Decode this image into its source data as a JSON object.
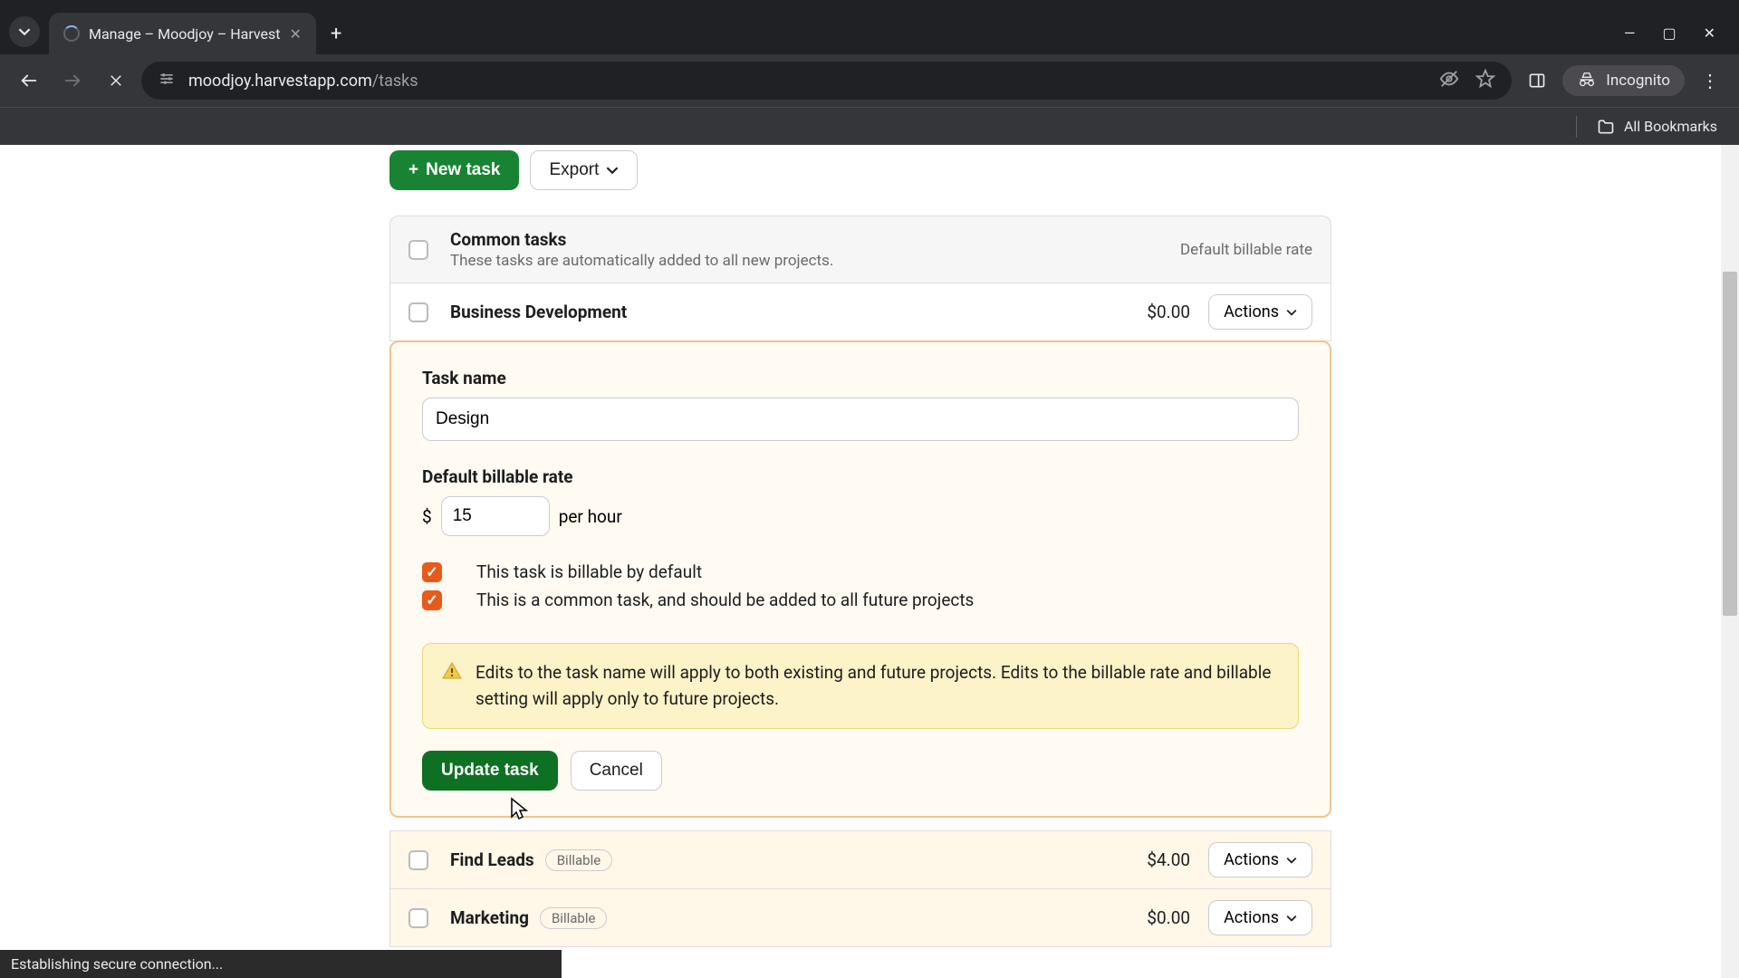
{
  "browser": {
    "tab_title": "Manage – Moodjoy – Harvest",
    "url_host": "moodjoy.harvestapp.com",
    "url_path": "/tasks",
    "incognito_label": "Incognito",
    "bookmarks_label": "All Bookmarks",
    "status_text": "Establishing secure connection..."
  },
  "toolbar": {
    "new_task": "New task",
    "export": "Export"
  },
  "section": {
    "title": "Common tasks",
    "subtitle": "These tasks are automatically added to all new projects.",
    "rate_header": "Default billable rate"
  },
  "tasks": {
    "business_dev": {
      "name": "Business Development",
      "rate": "$0.00",
      "actions": "Actions"
    },
    "find_leads": {
      "name": "Find Leads",
      "badge": "Billable",
      "rate": "$4.00",
      "actions": "Actions"
    },
    "marketing": {
      "name": "Marketing",
      "badge": "Billable",
      "rate": "$0.00",
      "actions": "Actions"
    }
  },
  "edit": {
    "name_label": "Task name",
    "name_value": "Design",
    "rate_label": "Default billable rate",
    "currency": "$",
    "rate_value": "15",
    "per_hour": "per hour",
    "billable_checkbox": "This task is billable by default",
    "common_checkbox": "This is a common task, and should be added to all future projects",
    "warning": "Edits to the task name will apply to both existing and future projects. Edits to the billable rate and billable setting will apply only to future projects.",
    "update_btn": "Update task",
    "cancel_btn": "Cancel"
  }
}
